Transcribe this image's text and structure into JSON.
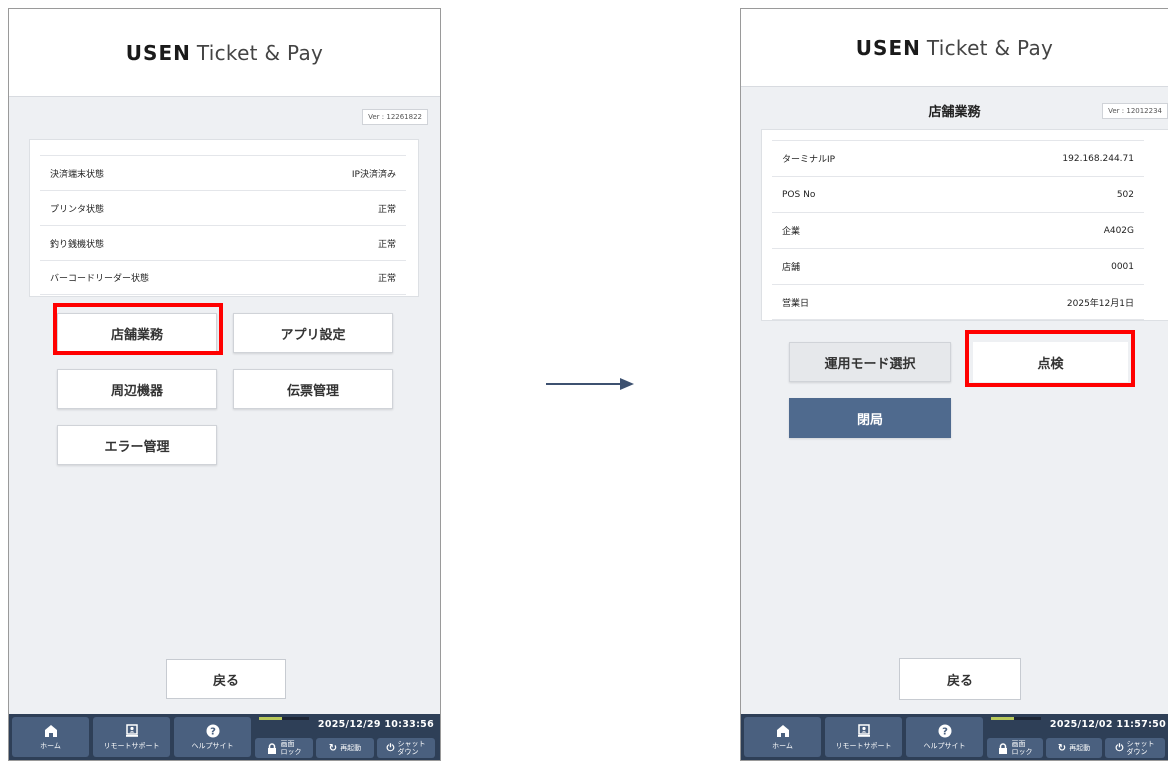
{
  "brand": {
    "strong": "USEN",
    "light": "Ticket & Pay"
  },
  "left": {
    "version": "Ver : 12261822",
    "status_rows": [
      {
        "label": "決済端末状態",
        "value": "IP決済済み"
      },
      {
        "label": "プリンタ状態",
        "value": "正常"
      },
      {
        "label": "釣り銭機状態",
        "value": "正常"
      },
      {
        "label": "バーコードリーダー状態",
        "value": "正常"
      }
    ],
    "menu": {
      "store_ops": "店舗業務",
      "app_settings": "アプリ設定",
      "peripherals": "周辺機器",
      "slip_mgmt": "伝票管理",
      "error_mgmt": "エラー管理"
    },
    "back": "戻る",
    "clock": "2025/12/29 10:33:56"
  },
  "right": {
    "title": "店舗業務",
    "version": "Ver : 12012234",
    "info_rows": [
      {
        "label": "ターミナルIP",
        "value": "192.168.244.71"
      },
      {
        "label": "POS No",
        "value": "502"
      },
      {
        "label": "企業",
        "value": "A402G"
      },
      {
        "label": "店舗",
        "value": "0001"
      },
      {
        "label": "営業日",
        "value": "2025年12月1日"
      }
    ],
    "buttons": {
      "mode_select": "運用モード選択",
      "inspect": "点検",
      "close": "閉局"
    },
    "back": "戻る",
    "clock": "2025/12/02 11:57:50"
  },
  "taskbar": {
    "home": "ホーム",
    "remote_support": "リモートサポート",
    "help_site": "ヘルプサイト",
    "screen_lock_l1": "画面",
    "screen_lock_l2": "ロック",
    "restart": "再起動",
    "shutdown_l1": "シャット",
    "shutdown_l2": "ダウン"
  },
  "colors": {
    "highlight": "#ff0000",
    "taskbar": "#2e3f57",
    "taskbar_button": "#4a607f",
    "close_button": "#4f6a8e",
    "arrow": "#3d5170"
  },
  "icons": {
    "home": "home-icon",
    "remote_support": "remote-support-icon",
    "help": "help-icon",
    "lock": "lock-icon",
    "restart": "restart-icon",
    "shutdown": "power-icon"
  }
}
